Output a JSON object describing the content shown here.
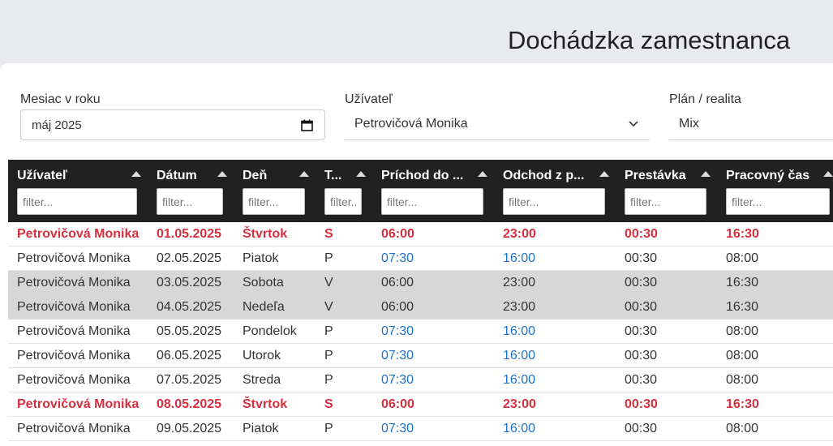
{
  "page": {
    "title": "Dochádzka zamestnanca"
  },
  "filters": {
    "month": {
      "label": "Mesiac v roku",
      "value": "máj 2025"
    },
    "user": {
      "label": "Užívateľ",
      "value": "Petrovičová Monika"
    },
    "plan": {
      "label": "Plán / realita",
      "value": "Mix"
    }
  },
  "grid": {
    "columns": [
      {
        "label": "Užívateľ",
        "placeholder": "filter..."
      },
      {
        "label": "Dátum",
        "placeholder": "filter..."
      },
      {
        "label": "Deň",
        "placeholder": "filter..."
      },
      {
        "label": "T...",
        "placeholder": "filter..."
      },
      {
        "label": "Príchod do ...",
        "placeholder": "filter..."
      },
      {
        "label": "Odchod z p...",
        "placeholder": "filter..."
      },
      {
        "label": "Prestávka",
        "placeholder": "filter..."
      },
      {
        "label": "Pracovný čas",
        "placeholder": "filter..."
      }
    ],
    "rows": [
      {
        "user": "Petrovičová Monika",
        "date": "01.05.2025",
        "day": "Štvrtok",
        "type": "S",
        "arrival": "06:00",
        "departure": "23:00",
        "break": "00:30",
        "work": "16:30",
        "style": "holiday"
      },
      {
        "user": "Petrovičová Monika",
        "date": "02.05.2025",
        "day": "Piatok",
        "type": "P",
        "arrival": "07:30",
        "departure": "16:00",
        "break": "00:30",
        "work": "08:00",
        "style": "normal"
      },
      {
        "user": "Petrovičová Monika",
        "date": "03.05.2025",
        "day": "Sobota",
        "type": "V",
        "arrival": "06:00",
        "departure": "23:00",
        "break": "00:30",
        "work": "16:30",
        "style": "weekend"
      },
      {
        "user": "Petrovičová Monika",
        "date": "04.05.2025",
        "day": "Nedeľa",
        "type": "V",
        "arrival": "06:00",
        "departure": "23:00",
        "break": "00:30",
        "work": "16:30",
        "style": "weekend"
      },
      {
        "user": "Petrovičová Monika",
        "date": "05.05.2025",
        "day": "Pondelok",
        "type": "P",
        "arrival": "07:30",
        "departure": "16:00",
        "break": "00:30",
        "work": "08:00",
        "style": "normal"
      },
      {
        "user": "Petrovičová Monika",
        "date": "06.05.2025",
        "day": "Utorok",
        "type": "P",
        "arrival": "07:30",
        "departure": "16:00",
        "break": "00:30",
        "work": "08:00",
        "style": "normal"
      },
      {
        "user": "Petrovičová Monika",
        "date": "07.05.2025",
        "day": "Streda",
        "type": "P",
        "arrival": "07:30",
        "departure": "16:00",
        "break": "00:30",
        "work": "08:00",
        "style": "normal"
      },
      {
        "user": "Petrovičová Monika",
        "date": "08.05.2025",
        "day": "Štvrtok",
        "type": "S",
        "arrival": "06:00",
        "departure": "23:00",
        "break": "00:30",
        "work": "16:30",
        "style": "holiday"
      },
      {
        "user": "Petrovičová Monika",
        "date": "09.05.2025",
        "day": "Piatok",
        "type": "P",
        "arrival": "07:30",
        "departure": "16:00",
        "break": "00:30",
        "work": "08:00",
        "style": "normal"
      }
    ]
  },
  "colors": {
    "holiday": "#d6303f",
    "time_blue": "#1a73c8",
    "weekend_row": "#d7d7d7",
    "header_bg": "#212121"
  },
  "icons": {
    "calendar": "calendar-icon",
    "chevron": "chevron-down-icon",
    "sort": "sort-ascending-icon"
  }
}
